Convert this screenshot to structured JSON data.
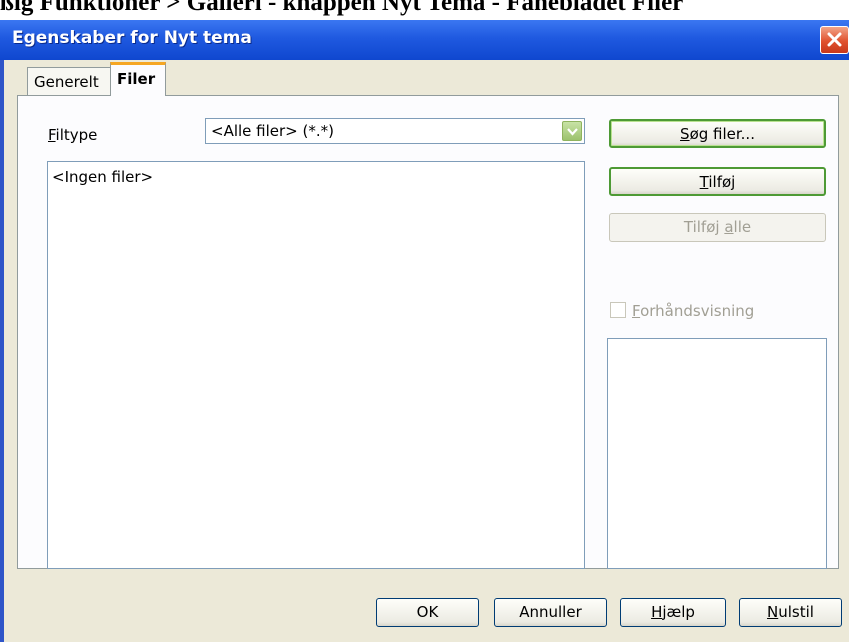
{
  "doc_heading": "ßig Funktioner > Galleri - knappen Nyt Tema - Fanebladet Filer",
  "window": {
    "title": "Egenskaber for Nyt tema"
  },
  "tabs": [
    {
      "label": "Generelt",
      "active": false
    },
    {
      "label": "Filer",
      "active": true
    }
  ],
  "filter": {
    "label": "Filtype",
    "value": "<Alle filer> (*.*)"
  },
  "file_list": {
    "empty_text": "<Ingen filer>"
  },
  "side_buttons": {
    "search": "Søg filer...",
    "add": "Tilføj",
    "add_all": "Tilføj alle"
  },
  "preview": {
    "label": "Forhåndsvisning",
    "checked": false,
    "enabled": false
  },
  "bottom_buttons": {
    "ok": "OK",
    "cancel": "Annuller",
    "help": "Hjælp",
    "reset": "Nulstil"
  },
  "colors": {
    "titlebar": "#1f59e0",
    "dialog_bg": "#ece9d8",
    "focus_green": "#4e9a35",
    "tab_accent": "#f5a623"
  }
}
